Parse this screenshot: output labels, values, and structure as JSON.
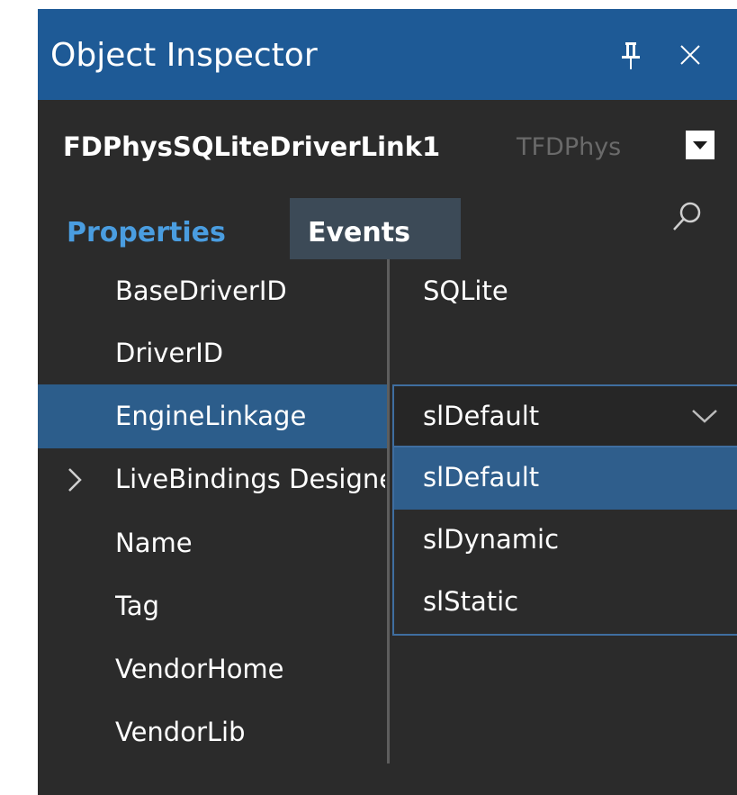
{
  "window": {
    "title": "Object Inspector",
    "pin_icon": "pin-icon",
    "close_icon": "close-icon"
  },
  "object_selector": {
    "name": "FDPhysSQLiteDriverLink1",
    "type": "TFDPhys",
    "dropdown_icon": "dropdown-arrow-icon"
  },
  "tabs": [
    {
      "label": "Properties",
      "active": true
    },
    {
      "label": "Events",
      "active": false
    }
  ],
  "search": {
    "value": "",
    "icon": "search-icon"
  },
  "properties": [
    {
      "name": "BaseDriverID",
      "value": "SQLite",
      "expandable": false,
      "selected": false
    },
    {
      "name": "DriverID",
      "value": "",
      "expandable": false,
      "selected": false
    },
    {
      "name": "EngineLinkage",
      "value": "slDefault",
      "expandable": false,
      "selected": true
    },
    {
      "name": "LiveBindings Designer",
      "value": "",
      "expandable": true,
      "selected": false
    },
    {
      "name": "Name",
      "value": "",
      "expandable": false,
      "selected": false
    },
    {
      "name": "Tag",
      "value": "",
      "expandable": false,
      "selected": false
    },
    {
      "name": "VendorHome",
      "value": "",
      "expandable": false,
      "selected": false
    },
    {
      "name": "VendorLib",
      "value": "",
      "expandable": false,
      "selected": false
    }
  ],
  "engine_linkage_dropdown": {
    "options": [
      "slDefault",
      "slDynamic",
      "slStatic"
    ],
    "highlighted": "slDefault"
  },
  "colors": {
    "titlebar": "#1e5a96",
    "panel_bg": "#2b2b2b",
    "selected_row": "#2c5d8b",
    "active_tab_text": "#4a9de0",
    "events_tab_bg": "#3c4a57"
  }
}
